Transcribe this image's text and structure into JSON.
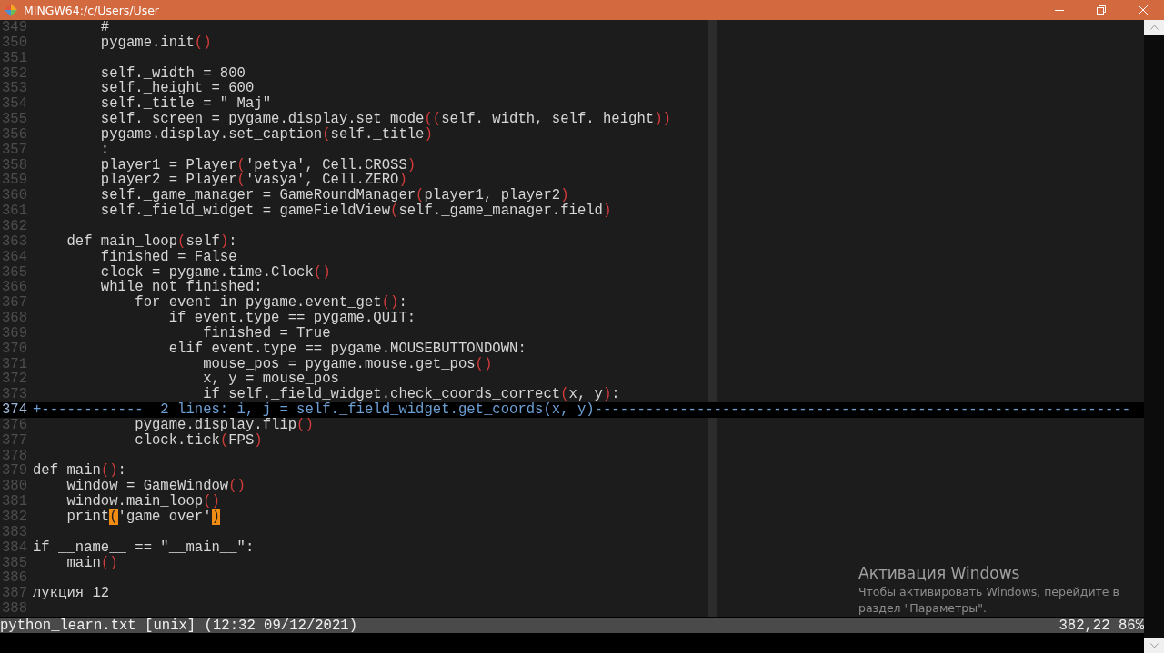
{
  "window": {
    "title": "MINGW64:/c/Users/User"
  },
  "editor": {
    "lines": [
      {
        "number": "349",
        "kind": "code",
        "segments": [
          {
            "text": "        #",
            "kind": "plain"
          }
        ]
      },
      {
        "number": "350",
        "kind": "code",
        "segments": [
          {
            "text": "        pygame.init",
            "kind": "plain"
          },
          {
            "text": "()",
            "kind": "paren"
          }
        ]
      },
      {
        "number": "351",
        "kind": "code"
      },
      {
        "number": "352",
        "kind": "code",
        "segments": [
          {
            "text": "        self._width = 800",
            "kind": "plain"
          }
        ]
      },
      {
        "number": "353",
        "kind": "code",
        "segments": [
          {
            "text": "        self._height = 600",
            "kind": "plain"
          }
        ]
      },
      {
        "number": "354",
        "kind": "code",
        "segments": [
          {
            "text": "        self._title = \" Maj\"",
            "kind": "plain"
          }
        ]
      },
      {
        "number": "355",
        "kind": "code",
        "segments": [
          {
            "text": "        self._screen = pygame.display.set_mode",
            "kind": "plain"
          },
          {
            "text": "((",
            "kind": "paren"
          },
          {
            "text": "self._width, self._height",
            "kind": "plain"
          },
          {
            "text": "))",
            "kind": "paren"
          }
        ]
      },
      {
        "number": "356",
        "kind": "code",
        "segments": [
          {
            "text": "        pygame.display.set_caption",
            "kind": "plain"
          },
          {
            "text": "(",
            "kind": "paren"
          },
          {
            "text": "self._title",
            "kind": "plain"
          },
          {
            "text": ")",
            "kind": "paren"
          }
        ]
      },
      {
        "number": "357",
        "kind": "code",
        "segments": [
          {
            "text": "        :",
            "kind": "plain"
          }
        ]
      },
      {
        "number": "358",
        "kind": "code",
        "segments": [
          {
            "text": "        player1 = Player",
            "kind": "plain"
          },
          {
            "text": "(",
            "kind": "paren"
          },
          {
            "text": "'petya', Cell.CROSS",
            "kind": "plain"
          },
          {
            "text": ")",
            "kind": "paren"
          }
        ]
      },
      {
        "number": "359",
        "kind": "code",
        "segments": [
          {
            "text": "        player2 = Player",
            "kind": "plain"
          },
          {
            "text": "(",
            "kind": "paren"
          },
          {
            "text": "'vasya', Cell.ZERO",
            "kind": "plain"
          },
          {
            "text": ")",
            "kind": "paren"
          }
        ]
      },
      {
        "number": "360",
        "kind": "code",
        "segments": [
          {
            "text": "        self._game_manager = GameRoundManager",
            "kind": "plain"
          },
          {
            "text": "(",
            "kind": "paren"
          },
          {
            "text": "player1, player2",
            "kind": "plain"
          },
          {
            "text": ")",
            "kind": "paren"
          }
        ]
      },
      {
        "number": "361",
        "kind": "code",
        "segments": [
          {
            "text": "        self._field_widget = gameFieldView",
            "kind": "plain"
          },
          {
            "text": "(",
            "kind": "paren"
          },
          {
            "text": "self._game_manager.field",
            "kind": "plain"
          },
          {
            "text": ")",
            "kind": "paren"
          }
        ]
      },
      {
        "number": "362",
        "kind": "code"
      },
      {
        "number": "363",
        "kind": "code",
        "segments": [
          {
            "text": "    def main_loop",
            "kind": "plain"
          },
          {
            "text": "(",
            "kind": "paren"
          },
          {
            "text": "self",
            "kind": "plain"
          },
          {
            "text": ")",
            "kind": "paren"
          },
          {
            "text": ":",
            "kind": "plain"
          }
        ]
      },
      {
        "number": "364",
        "kind": "code",
        "segments": [
          {
            "text": "        finished = False",
            "kind": "plain"
          }
        ]
      },
      {
        "number": "365",
        "kind": "code",
        "segments": [
          {
            "text": "        clock = pygame.time.Clock",
            "kind": "plain"
          },
          {
            "text": "()",
            "kind": "paren"
          }
        ]
      },
      {
        "number": "366",
        "kind": "code",
        "segments": [
          {
            "text": "        while not finished:",
            "kind": "plain"
          }
        ]
      },
      {
        "number": "367",
        "kind": "code",
        "segments": [
          {
            "text": "            for event in pygame.event_get",
            "kind": "plain"
          },
          {
            "text": "()",
            "kind": "paren"
          },
          {
            "text": ":",
            "kind": "plain"
          }
        ]
      },
      {
        "number": "368",
        "kind": "code",
        "segments": [
          {
            "text": "                if event.type == pygame.QUIT:",
            "kind": "plain"
          }
        ]
      },
      {
        "number": "369",
        "kind": "code",
        "segments": [
          {
            "text": "                    finished = True",
            "kind": "plain"
          }
        ]
      },
      {
        "number": "370",
        "kind": "code",
        "segments": [
          {
            "text": "                elif event.type == pygame.MOUSEBUTTONDOWN:",
            "kind": "plain"
          }
        ]
      },
      {
        "number": "371",
        "kind": "code",
        "segments": [
          {
            "text": "                    mouse_pos = pygame.mouse.get_pos",
            "kind": "plain"
          },
          {
            "text": "()",
            "kind": "paren"
          }
        ]
      },
      {
        "number": "372",
        "kind": "code",
        "segments": [
          {
            "text": "                    x, y = mouse_pos",
            "kind": "plain"
          }
        ]
      },
      {
        "number": "373",
        "kind": "code",
        "segments": [
          {
            "text": "                    if self._field_widget.check_coords_correct",
            "kind": "plain"
          },
          {
            "text": "(",
            "kind": "paren"
          },
          {
            "text": "x, y",
            "kind": "plain"
          },
          {
            "text": ")",
            "kind": "paren"
          },
          {
            "text": ":",
            "kind": "plain"
          }
        ]
      },
      {
        "number": "374",
        "kind": "fold",
        "segments": [
          {
            "text": "+------------  2 lines: i, j = self._field_widget.get_coords(x, y)---------------------------------------------------------------",
            "kind": "plain"
          }
        ]
      },
      {
        "number": "376",
        "kind": "code",
        "segments": [
          {
            "text": "            pygame.display.flip",
            "kind": "plain"
          },
          {
            "text": "()",
            "kind": "paren"
          }
        ]
      },
      {
        "number": "377",
        "kind": "code",
        "segments": [
          {
            "text": "            clock.tick",
            "kind": "plain"
          },
          {
            "text": "(",
            "kind": "paren"
          },
          {
            "text": "FPS",
            "kind": "plain"
          },
          {
            "text": ")",
            "kind": "paren"
          }
        ]
      },
      {
        "number": "378",
        "kind": "code"
      },
      {
        "number": "379",
        "kind": "code",
        "segments": [
          {
            "text": "def main",
            "kind": "plain"
          },
          {
            "text": "()",
            "kind": "paren"
          },
          {
            "text": ":",
            "kind": "plain"
          }
        ]
      },
      {
        "number": "380",
        "kind": "code",
        "segments": [
          {
            "text": "    window = GameWindow",
            "kind": "plain"
          },
          {
            "text": "()",
            "kind": "paren"
          }
        ]
      },
      {
        "number": "381",
        "kind": "code",
        "segments": [
          {
            "text": "    window.main_loop",
            "kind": "plain"
          },
          {
            "text": "()",
            "kind": "paren"
          }
        ]
      },
      {
        "number": "382",
        "kind": "code",
        "segments": [
          {
            "text": "    print",
            "kind": "plain"
          },
          {
            "text": "(",
            "kind": "match"
          },
          {
            "text": "'game over'",
            "kind": "plain"
          },
          {
            "text": ")",
            "kind": "match"
          }
        ]
      },
      {
        "number": "383",
        "kind": "code"
      },
      {
        "number": "384",
        "kind": "code",
        "segments": [
          {
            "text": "if __name__ == \"__main__\":",
            "kind": "plain"
          }
        ]
      },
      {
        "number": "385",
        "kind": "code",
        "segments": [
          {
            "text": "    main",
            "kind": "plain"
          },
          {
            "text": "()",
            "kind": "paren"
          }
        ]
      },
      {
        "number": "386",
        "kind": "code"
      },
      {
        "number": "387",
        "kind": "code",
        "segments": [
          {
            "text": "лукция 12",
            "kind": "plain"
          }
        ]
      },
      {
        "number": "388",
        "kind": "code"
      }
    ]
  },
  "status_bar": {
    "file_info": "python_learn.txt [unix] (12:32 09/12/2021)",
    "position": "382,22 86%"
  },
  "activation_notice": {
    "title": "Активация Windows",
    "message": "Чтобы активировать Windows, перейдите в раздел \"Параметры\"."
  }
}
